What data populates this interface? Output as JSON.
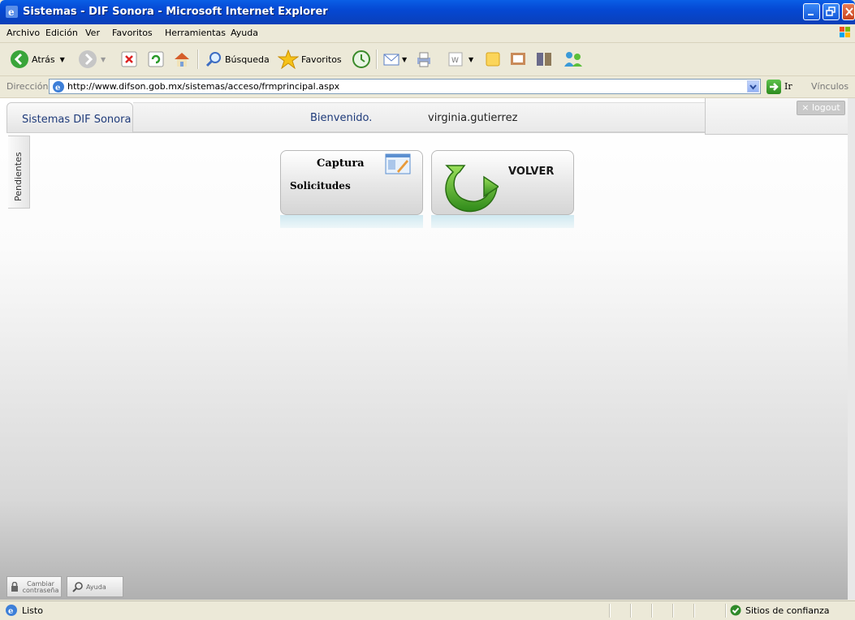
{
  "window": {
    "title": "Sistemas - DIF Sonora - Microsoft Internet Explorer"
  },
  "menu": [
    "Archivo",
    "Edición",
    "Ver",
    "Favoritos",
    "Herramientas",
    "Ayuda"
  ],
  "toolbar": {
    "back_label": "Atrás",
    "search_label": "Búsqueda",
    "favorites_label": "Favoritos"
  },
  "address": {
    "label": "Dirección",
    "url": "http://www.difson.gob.mx/sistemas/acceso/frmprincipal.aspx",
    "go_label": "Ir",
    "links_label": "Vínculos"
  },
  "app": {
    "home_tab": "Sistemas DIF Sonora",
    "welcome": "Bienvenido.",
    "user": "virginia.gutierrez",
    "logout": "logout",
    "side_tab": "Pendientes"
  },
  "tiles": [
    {
      "title": "Captura",
      "subtitle": "Solicitudes"
    },
    {
      "title": "VOLVER"
    }
  ],
  "bottom": {
    "change_password": "Cambiar contraseña",
    "help": "Ayuda"
  },
  "status": {
    "ready": "Listo",
    "zone": "Sitios de confianza"
  }
}
